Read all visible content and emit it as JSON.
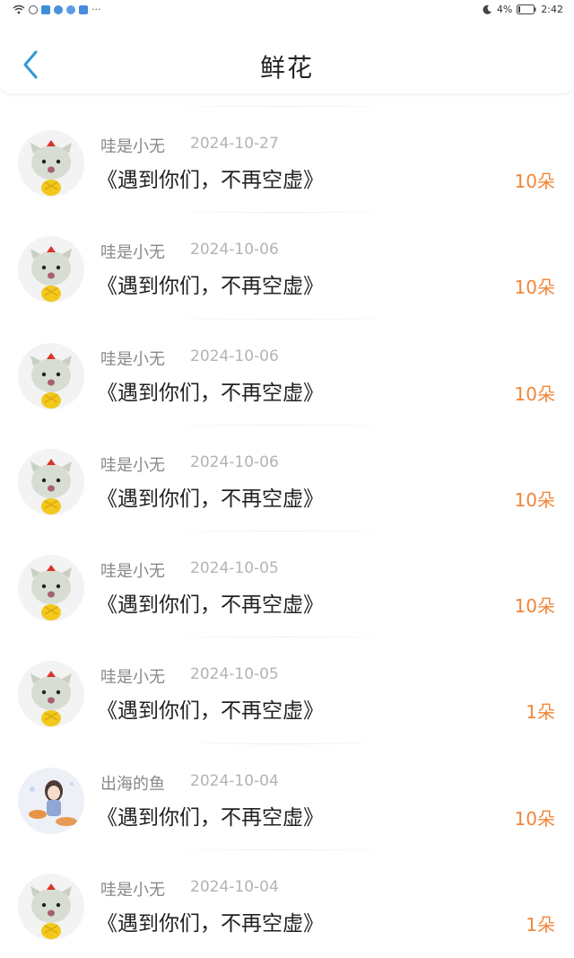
{
  "status_bar": {
    "left_more": "···",
    "battery_percent": "4%",
    "time": "2:42"
  },
  "header": {
    "title": "鲜花"
  },
  "colors": {
    "accent_blue": "#2e9ad6",
    "count_orange": "#f0863a",
    "name_gray": "#888888",
    "date_gray": "#b3b3b3"
  },
  "records": [
    {
      "name": "哇是小无",
      "date": "2024-10-27",
      "book": "《遇到你们，不再空虚》",
      "count": "10朵",
      "avatar": "hamster-avatar"
    },
    {
      "name": "哇是小无",
      "date": "2024-10-06",
      "book": "《遇到你们，不再空虚》",
      "count": "10朵",
      "avatar": "hamster-avatar"
    },
    {
      "name": "哇是小无",
      "date": "2024-10-06",
      "book": "《遇到你们，不再空虚》",
      "count": "10朵",
      "avatar": "hamster-avatar"
    },
    {
      "name": "哇是小无",
      "date": "2024-10-06",
      "book": "《遇到你们，不再空虚》",
      "count": "10朵",
      "avatar": "hamster-avatar"
    },
    {
      "name": "哇是小无",
      "date": "2024-10-05",
      "book": "《遇到你们，不再空虚》",
      "count": "10朵",
      "avatar": "hamster-avatar"
    },
    {
      "name": "哇是小无",
      "date": "2024-10-05",
      "book": "《遇到你们，不再空虚》",
      "count": "1朵",
      "avatar": "hamster-avatar"
    },
    {
      "name": "出海的鱼",
      "date": "2024-10-04",
      "book": "《遇到你们，不再空虚》",
      "count": "10朵",
      "avatar": "anime-girl-avatar"
    },
    {
      "name": "哇是小无",
      "date": "2024-10-04",
      "book": "《遇到你们，不再空虚》",
      "count": "1朵",
      "avatar": "hamster-avatar"
    }
  ]
}
